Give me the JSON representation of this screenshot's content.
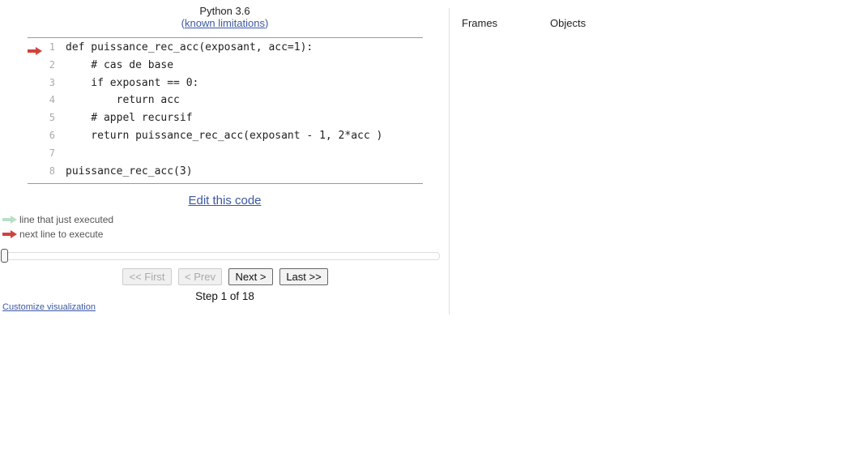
{
  "header": {
    "language": "Python 3.6",
    "limitations_prefix": "(",
    "limitations_link": "known limitations",
    "limitations_suffix": ")"
  },
  "code": {
    "current_line": 1,
    "lines": [
      {
        "no": "1",
        "text": "def puissance_rec_acc(exposant, acc=1):"
      },
      {
        "no": "2",
        "text": "    # cas de base"
      },
      {
        "no": "3",
        "text": "    if exposant == 0:"
      },
      {
        "no": "4",
        "text": "        return acc"
      },
      {
        "no": "5",
        "text": "    # appel recursif"
      },
      {
        "no": "6",
        "text": "    return puissance_rec_acc(exposant - 1, 2*acc )"
      },
      {
        "no": "7",
        "text": ""
      },
      {
        "no": "8",
        "text": "puissance_rec_acc(3)"
      }
    ]
  },
  "edit_link": "Edit this code",
  "legend": {
    "executed": "line that just executed",
    "next": "next line to execute"
  },
  "colors": {
    "next_arrow": "#d0433c",
    "executed_arrow": "#b8e0c8",
    "link": "#3d58a2"
  },
  "slider": {
    "position": 0
  },
  "nav": {
    "first": "<< First",
    "prev": "< Prev",
    "next": "Next >",
    "last": "Last >>"
  },
  "step": {
    "text": "Step 1 of 18",
    "current": 1,
    "total": 18
  },
  "customize": "Customize visualization",
  "viz": {
    "frames_header": "Frames",
    "objects_header": "Objects"
  }
}
